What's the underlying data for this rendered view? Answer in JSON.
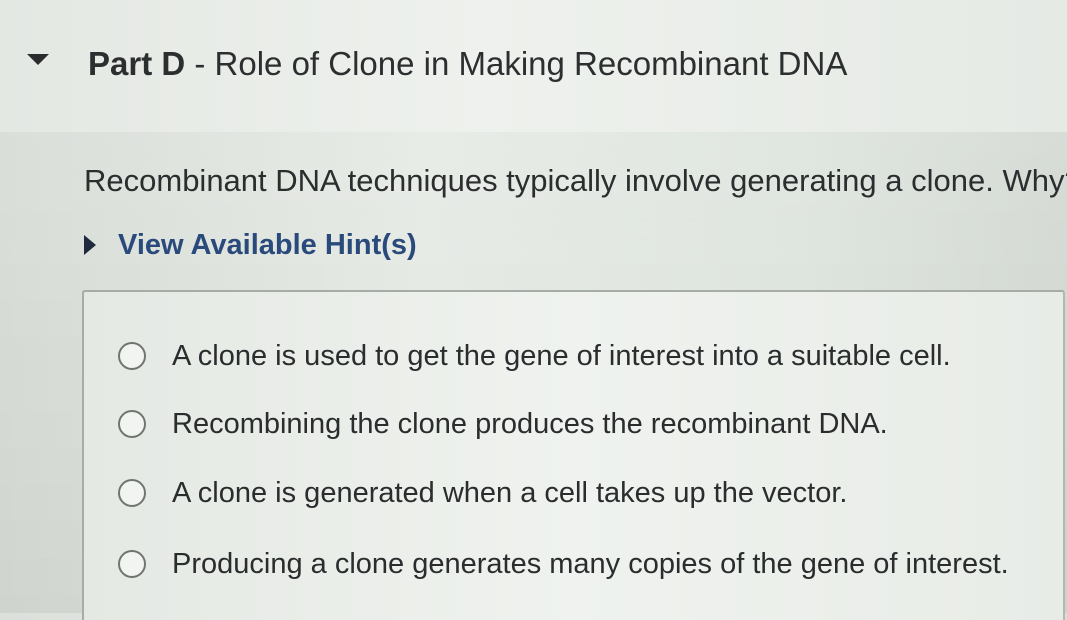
{
  "part": {
    "prefix": "Part D",
    "separator": " - ",
    "title": "Role of Clone in Making Recombinant DNA"
  },
  "question": {
    "text": "Recombinant DNA techniques typically involve generating a clone. Why?"
  },
  "hint": {
    "label": "View Available Hint(s)"
  },
  "options": [
    {
      "label": "A clone is used to get the gene of interest into a suitable cell."
    },
    {
      "label": "Recombining the clone produces the recombinant DNA."
    },
    {
      "label": "A clone is generated when a cell takes up the vector."
    },
    {
      "label": "Producing a clone generates many copies of the gene of interest."
    }
  ],
  "colors": {
    "hint_link": "#2a4a7c",
    "text": "#2b2d2f",
    "radio_border": "#6f7670"
  }
}
